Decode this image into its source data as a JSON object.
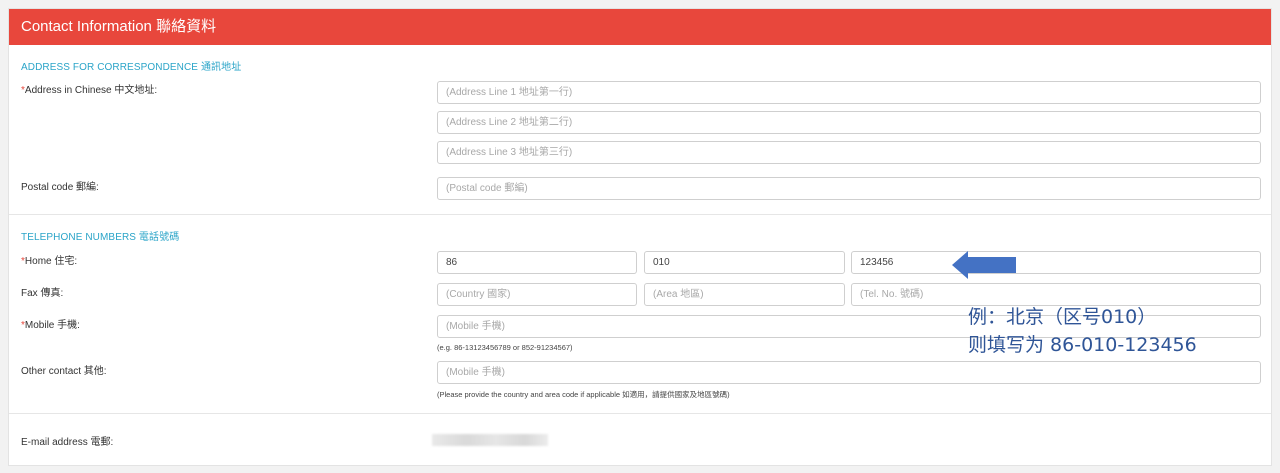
{
  "header": {
    "title": "Contact Information 聯絡資料"
  },
  "address": {
    "section_title": "ADDRESS FOR CORRESPONDENCE 通訊地址",
    "chinese_label_req": "*",
    "chinese_label": "Address in Chinese 中文地址:",
    "line1_placeholder": "(Address Line 1 地址第一行)",
    "line2_placeholder": "(Address Line 2 地址第二行)",
    "line3_placeholder": "(Address Line 3 地址第三行)",
    "postal_label": "Postal code 郵編:",
    "postal_placeholder": "(Postal code 郵編)"
  },
  "telephone": {
    "section_title": "TELEPHONE NUMBERS 電話號碼",
    "home_req": "*",
    "home_label": "Home 住宅:",
    "home_country": "86",
    "home_area": "010",
    "home_number": "123456",
    "fax_label": "Fax 傳真:",
    "fax_country_placeholder": "(Country 國家)",
    "fax_area_placeholder": "(Area 地區)",
    "fax_tel_placeholder": "(Tel. No. 號碼)",
    "mobile_req": "*",
    "mobile_label": "Mobile 手機:",
    "mobile_placeholder": "(Mobile 手機)",
    "mobile_help": "(e.g. 86-13123456789 or 852-91234567)",
    "other_label": "Other contact 其他:",
    "other_placeholder": "(Mobile 手機)",
    "other_help": "(Please provide the country and area code if applicable 如適用，請提供國家及地區號碼)"
  },
  "email": {
    "label": "E-mail address 電郵:"
  },
  "annotation": {
    "line1": "例：北京（区号010）",
    "line2": "则填写为 86-010-123456",
    "color": "#2f5597",
    "arrow_color": "#4472c4"
  }
}
